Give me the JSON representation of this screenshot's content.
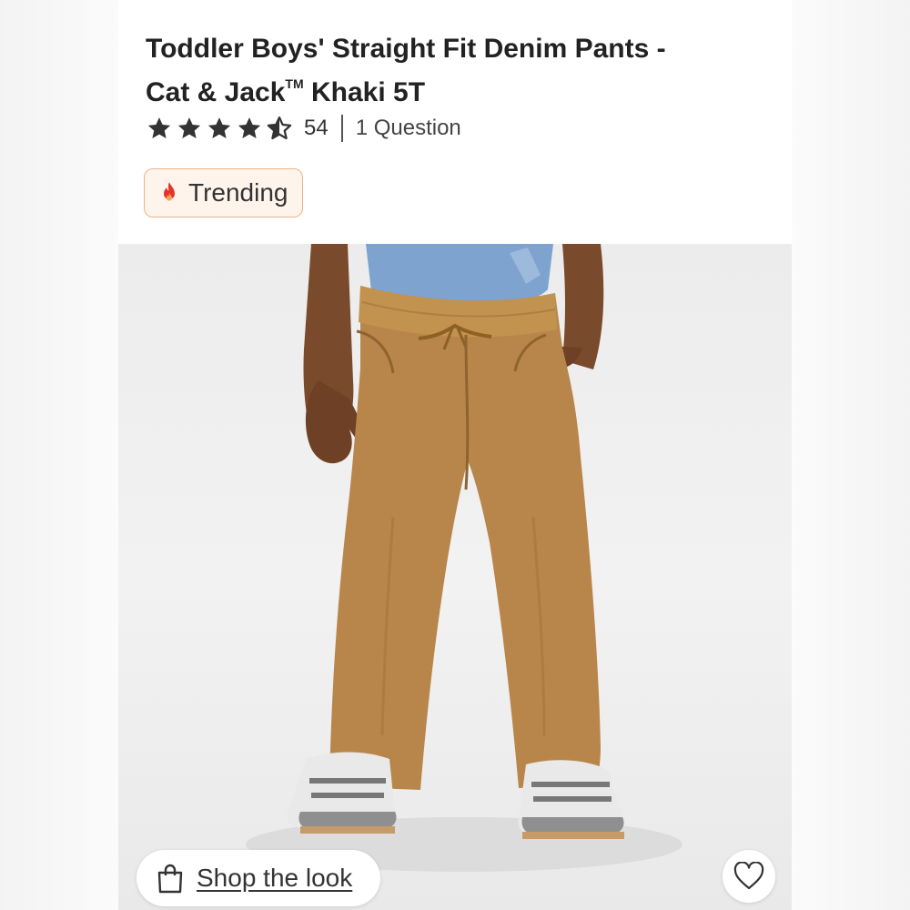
{
  "product": {
    "title_line1": "Toddler Boys' Straight Fit Denim Pants -",
    "title_line2_a": "Cat & Jack",
    "title_tm": "TM",
    "title_line2_b": " Khaki 5T"
  },
  "rating": {
    "stars_value": 4.5,
    "stars_max": 5,
    "review_count": "54",
    "questions": "1 Question"
  },
  "badge": {
    "label": "Trending",
    "icon": "fire-icon"
  },
  "actions": {
    "shop_the_look": "Shop the look",
    "shop_icon": "shopping-bag-icon",
    "favorite_icon": "heart-icon"
  },
  "colors": {
    "badge_border": "#e8b48b",
    "badge_bg": "#fff4ec",
    "fire": "#e4322b",
    "pants": "#b8864a",
    "shirt": "#7fa3cf"
  }
}
